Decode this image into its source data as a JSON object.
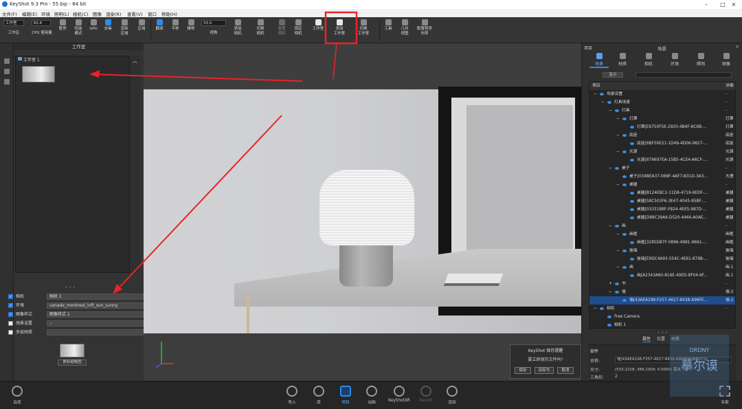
{
  "window": {
    "title": "KeyShot 9.3 Pro  -  55.bip  - 64 bit",
    "controls": [
      "–",
      "□",
      "×"
    ]
  },
  "menu": [
    "文件(F)",
    "编辑(E)",
    "环境",
    "照明(L)",
    "相机(C)",
    "图像",
    "渲染(R)",
    "查看(V)",
    "窗口",
    "帮助(H)"
  ],
  "toolbar": {
    "workspace_select": "工作室",
    "workspace_label": "工作区",
    "cpu_value": "82.6",
    "cpu_label": "CPU 使用量",
    "pause_label": "暂停",
    "performance_label": "性能\n模式",
    "gpu_label": "GPU",
    "denoise_label": "去噪",
    "render_region_label": "渲染\n区域",
    "region_label": "区域",
    "refresh_label": "翻滚",
    "pan_label": "平移",
    "dolly_label": "推移",
    "fov_value": "33.0",
    "fov_label": "视角",
    "add_camera_label": "添加\n相机",
    "switch_camera_label": "切换\n相机",
    "reset_camera_label": "重置\n相机",
    "lock_camera_label": "锁定\n相机",
    "studio_label": "工作室",
    "add_studio_label": "添加\n工作室",
    "switch_studio_label": "切换\n工作室",
    "tools_label": "工具",
    "geometry_view_label": "几何\n视图",
    "config_wizard_label": "配置程序\n向导"
  },
  "left_panel": {
    "title": "工作室",
    "studio_item": "工作室 1",
    "props": [
      {
        "label": "相机",
        "value": "相机 1",
        "checked": true
      },
      {
        "label": "环境",
        "value": "canada_montreal_loft_sun_sunny",
        "checked": true
      },
      {
        "label": "图像样式",
        "value": "图像样式 1",
        "checked": true
      },
      {
        "label": "场景设置",
        "value": "--",
        "checked": false
      },
      {
        "label": "多层材质",
        "value": "",
        "checked": false
      }
    ],
    "update_thumb_button": "更新缩略图"
  },
  "save_dialog": {
    "title": "KeyShot 保存提醒",
    "message": "要立即保存文件吗?",
    "save": "保存",
    "save_as": "另存为",
    "cancel": "取消"
  },
  "right_panel": {
    "header_left": "项目",
    "title": "场景",
    "tabs": [
      "场景",
      "材质",
      "相机",
      "环境",
      "照明",
      "图像"
    ],
    "display_button": "显示",
    "tree_col_item": "项目",
    "tree_col_detail": "详细",
    "tree": [
      {
        "name": "场景设置",
        "right": "-",
        "indent": 0,
        "exp": "−"
      },
      {
        "name": "灯具场景",
        "right": "-",
        "indent": 1,
        "exp": "−"
      },
      {
        "name": "灯具",
        "right": "-",
        "indent": 2,
        "exp": "−"
      },
      {
        "name": "灯罩",
        "right": "灯罩",
        "indent": 3,
        "exp": "−"
      },
      {
        "name": "灯罩[E9750F5E-2920-4B4F-8C6B-...",
        "right": "灯罩",
        "indent": 4,
        "exp": ""
      },
      {
        "name": "底座",
        "right": "底座",
        "indent": 3,
        "exp": "−"
      },
      {
        "name": "底座[6BF00E21-1D49-4D06-9827-...",
        "right": "底座",
        "indent": 4,
        "exp": ""
      },
      {
        "name": "光源",
        "right": "光源",
        "indent": 3,
        "exp": "−"
      },
      {
        "name": "光源[879697EA-15B5-4CE4-A6CF-...",
        "right": "光源",
        "indent": 4,
        "exp": ""
      },
      {
        "name": "桌子",
        "right": "-",
        "indent": 2,
        "exp": "−"
      },
      {
        "name": "桌子[034BEA37-068F-4AF7-B31D-3A3...",
        "right": "大理",
        "indent": 3,
        "exp": ""
      },
      {
        "name": "桌腿",
        "right": "-",
        "indent": 3,
        "exp": "−"
      },
      {
        "name": "桌腿[B124EBC2-11D8-4719-8EDF-...",
        "right": "桌腿",
        "indent": 4,
        "exp": ""
      },
      {
        "name": "桌腿[58C503F6-3E47-4045-95BF-...",
        "right": "桌腿",
        "indent": 4,
        "exp": ""
      },
      {
        "name": "桌腿[0333188F-F824-4EE5-987D-...",
        "right": "桌腿",
        "indent": 4,
        "exp": ""
      },
      {
        "name": "桌腿[D88C39A6-D520-4466-A0AE...",
        "right": "桌腿",
        "indent": 4,
        "exp": ""
      },
      {
        "name": "画",
        "right": "-",
        "indent": 2,
        "exp": "−"
      },
      {
        "name": "画框",
        "right": "画框",
        "indent": 3,
        "exp": "−"
      },
      {
        "name": "画框[3285D87F-0896-4981-9661-...",
        "right": "画框",
        "indent": 4,
        "exp": ""
      },
      {
        "name": "玻璃",
        "right": "玻璃",
        "indent": 3,
        "exp": "−"
      },
      {
        "name": "玻璃[E9DC4A93-554C-4E61-879B-...",
        "right": "玻璃",
        "indent": 4,
        "exp": ""
      },
      {
        "name": "画",
        "right": "画.1",
        "indent": 3,
        "exp": "−"
      },
      {
        "name": "画[A2343A60-816E-49D5-8F04-6F...",
        "right": "画.1",
        "indent": 4,
        "exp": ""
      },
      {
        "name": "书",
        "right": "-",
        "indent": 2,
        "exp": "+"
      },
      {
        "name": "墙",
        "right": "墙-2",
        "indent": 2,
        "exp": "−"
      },
      {
        "name": "墙[43AEA198-F257-4617-8438-A96FE...",
        "right": "墙-2",
        "indent": 3,
        "exp": "",
        "sel": true
      },
      {
        "name": "相机",
        "right": "-",
        "indent": 0,
        "exp": "−"
      },
      {
        "name": "Free Camera",
        "right": "",
        "indent": 1,
        "exp": ""
      },
      {
        "name": "相机 1",
        "right": "",
        "indent": 1,
        "exp": ""
      }
    ],
    "prop_tabs": [
      "属性",
      "位置",
      "材质"
    ],
    "section": "部件",
    "name_label": "名称:",
    "name_value": "墙[43AEA198-F257-4617-8438-A96FE6DB8D72]",
    "size_label": "尺寸:",
    "size_value": "(533.2218; 389.2304; 0.0000) 毫米",
    "tri_label": "三角形:",
    "tri_value": "2"
  },
  "bottom_bar": {
    "cloud": "云库",
    "items": [
      {
        "label": "导入",
        "state": "normal"
      },
      {
        "label": "库",
        "state": "normal"
      },
      {
        "label": "项目",
        "state": "active"
      },
      {
        "label": "动画",
        "state": "normal"
      },
      {
        "label": "KeyShotXR",
        "state": "normal"
      },
      {
        "label": "KeyVR",
        "state": "disabled"
      },
      {
        "label": "渲染",
        "state": "normal"
      }
    ],
    "expert": "专家"
  },
  "watermark": {
    "line1": "DRDNY",
    "line2": "摹尔谟"
  },
  "colors": {
    "accent": "#2d8be8",
    "highlight_box": "#e8232a",
    "arrow": "#e8232a"
  }
}
